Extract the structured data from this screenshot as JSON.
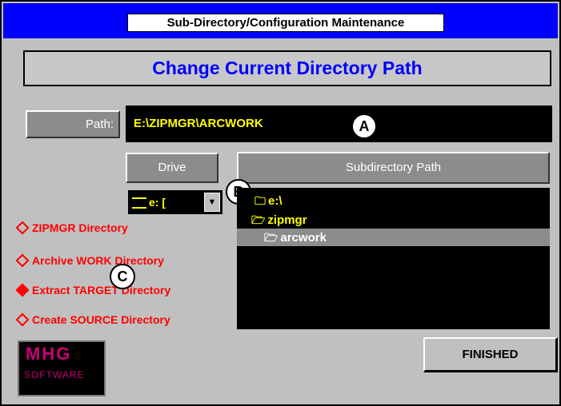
{
  "window": {
    "title": "Sub-Directory/Configuration  Maintenance"
  },
  "panel": {
    "heading": "Change Current Directory Path"
  },
  "path": {
    "label": "Path:",
    "value": "E:\\ZIPMGR\\ARCWORK"
  },
  "drive": {
    "button_label": "Drive",
    "selected": "e: [",
    "dropdown_arrow": "▼"
  },
  "subdirectory": {
    "button_label": "Subdirectory Path",
    "items": [
      {
        "icon": "folder-open-icon",
        "label": "e:\\"
      },
      {
        "icon": "folder-open-icon",
        "label": "zipmgr"
      },
      {
        "icon": "folder-open-icon",
        "label": "arcwork",
        "selected": true
      }
    ]
  },
  "options": [
    {
      "label": "ZIPMGR Directory"
    },
    {
      "label": "Archive WORK Directory"
    },
    {
      "label": "Extract TARGET Directory",
      "selected": true
    },
    {
      "label": "Create SOURCE Directory"
    }
  ],
  "callouts": {
    "a": "A",
    "b": "B",
    "c": "C"
  },
  "logo": {
    "text": "MHG",
    "sub": "SOFTWARE"
  },
  "actions": {
    "finished_label": "FINISHED"
  },
  "colors": {
    "title_bar": "#0000ff",
    "heading_text": "#0000ff",
    "path_text": "#ffff00",
    "option_text": "#ff0000",
    "list_bg": "#000000"
  }
}
